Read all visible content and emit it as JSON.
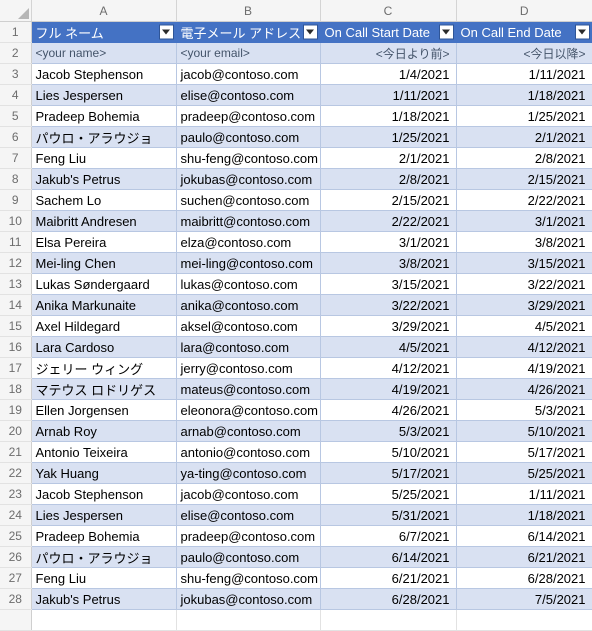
{
  "grid": {
    "column_letters": [
      "A",
      "B",
      "C",
      "D"
    ],
    "row_numbers": [
      "1",
      "2",
      "3",
      "4",
      "5",
      "6",
      "7",
      "8",
      "9",
      "10",
      "11",
      "12",
      "13",
      "14",
      "15",
      "16",
      "17",
      "18",
      "19",
      "20",
      "21",
      "22",
      "23",
      "24",
      "25",
      "26",
      "27",
      "28"
    ],
    "select_all_icon": "select-all-triangle",
    "filter_icon": "filter-dropdown-icon",
    "resize_icon": "table-resize-handle"
  },
  "colors": {
    "header_fill": "#4472C4",
    "header_text": "#FFFFFF",
    "band_fill": "#D9E1F2",
    "band_alt_fill": "#FFFFFF",
    "border": "#B8C7E2",
    "gutter_fill": "#F5F5F5",
    "gutter_text": "#6D6D6D",
    "placeholder_text": "#44546A"
  },
  "table": {
    "headers": [
      {
        "label": "フル ネーム",
        "align": "left"
      },
      {
        "label": "電子メール アドレス",
        "align": "left"
      },
      {
        "label": "On Call Start Date",
        "align": "left"
      },
      {
        "label": "On Call End Date",
        "align": "left"
      }
    ],
    "placeholder_row": {
      "name": "<your name>",
      "email": "<your email>",
      "start": "<今日より前>",
      "end": "<今日以降>"
    },
    "rows": [
      {
        "name": "Jacob Stephenson",
        "email": "jacob@contoso.com",
        "start": "1/4/2021",
        "end": "1/11/2021"
      },
      {
        "name": "Lies Jespersen",
        "email": "elise@contoso.com",
        "start": "1/11/2021",
        "end": "1/18/2021"
      },
      {
        "name": "Pradeep Bohemia",
        "email": "pradeep@contoso.com",
        "start": "1/18/2021",
        "end": "1/25/2021"
      },
      {
        "name": "パウロ・アラウジョ",
        "email": "paulo@contoso.com",
        "start": "1/25/2021",
        "end": "2/1/2021"
      },
      {
        "name": "Feng Liu",
        "email": "shu-feng@contoso.com",
        "start": "2/1/2021",
        "end": "2/8/2021"
      },
      {
        "name": "Jakub's Petrus",
        "email": "jokubas@contoso.com",
        "start": "2/8/2021",
        "end": "2/15/2021"
      },
      {
        "name": "Sachem Lo",
        "email": "suchen@contoso.com",
        "start": "2/15/2021",
        "end": "2/22/2021"
      },
      {
        "name": "Maibritt Andresen",
        "email": "maibritt@contoso.com",
        "start": "2/22/2021",
        "end": "3/1/2021"
      },
      {
        "name": "Elsa Pereira",
        "email": "elza@contoso.com",
        "start": "3/1/2021",
        "end": "3/8/2021"
      },
      {
        "name": "Mei-ling Chen",
        "email": "mei-ling@contoso.com",
        "start": "3/8/2021",
        "end": "3/15/2021"
      },
      {
        "name": "Lukas Søndergaard",
        "email": "lukas@contoso.com",
        "start": "3/15/2021",
        "end": "3/22/2021"
      },
      {
        "name": "Anika Markunaite",
        "email": "anika@contoso.com",
        "start": "3/22/2021",
        "end": "3/29/2021"
      },
      {
        "name": "Axel Hildegard",
        "email": "aksel@contoso.com",
        "start": "3/29/2021",
        "end": "4/5/2021"
      },
      {
        "name": "Lara Cardoso",
        "email": "lara@contoso.com",
        "start": "4/5/2021",
        "end": "4/12/2021"
      },
      {
        "name": "ジェリー ウィング",
        "email": "jerry@contoso.com",
        "start": "4/12/2021",
        "end": "4/19/2021"
      },
      {
        "name": "マテウス ロドリゲス",
        "email": "mateus@contoso.com",
        "start": "4/19/2021",
        "end": "4/26/2021"
      },
      {
        "name": "Ellen Jorgensen",
        "email": "eleonora@contoso.com",
        "start": "4/26/2021",
        "end": "5/3/2021"
      },
      {
        "name": "Arnab Roy",
        "email": "arnab@contoso.com",
        "start": "5/3/2021",
        "end": "5/10/2021"
      },
      {
        "name": "Antonio Teixeira",
        "email": "antonio@contoso.com",
        "start": "5/10/2021",
        "end": "5/17/2021"
      },
      {
        "name": "Yak Huang",
        "email": "ya-ting@contoso.com",
        "start": "5/17/2021",
        "end": "5/25/2021"
      },
      {
        "name": "Jacob Stephenson",
        "email": "jacob@contoso.com",
        "start": "5/25/2021",
        "end": "1/11/2021"
      },
      {
        "name": "Lies Jespersen",
        "email": "elise@contoso.com",
        "start": "5/31/2021",
        "end": "1/18/2021"
      },
      {
        "name": "Pradeep Bohemia",
        "email": "pradeep@contoso.com",
        "start": "6/7/2021",
        "end": "6/14/2021"
      },
      {
        "name": "パウロ・アラウジョ",
        "email": "paulo@contoso.com",
        "start": "6/14/2021",
        "end": "6/21/2021"
      },
      {
        "name": "Feng Liu",
        "email": "shu-feng@contoso.com",
        "start": "6/21/2021",
        "end": "6/28/2021"
      },
      {
        "name": "Jakub's Petrus",
        "email": "jokubas@contoso.com",
        "start": "6/28/2021",
        "end": "7/5/2021"
      }
    ]
  }
}
